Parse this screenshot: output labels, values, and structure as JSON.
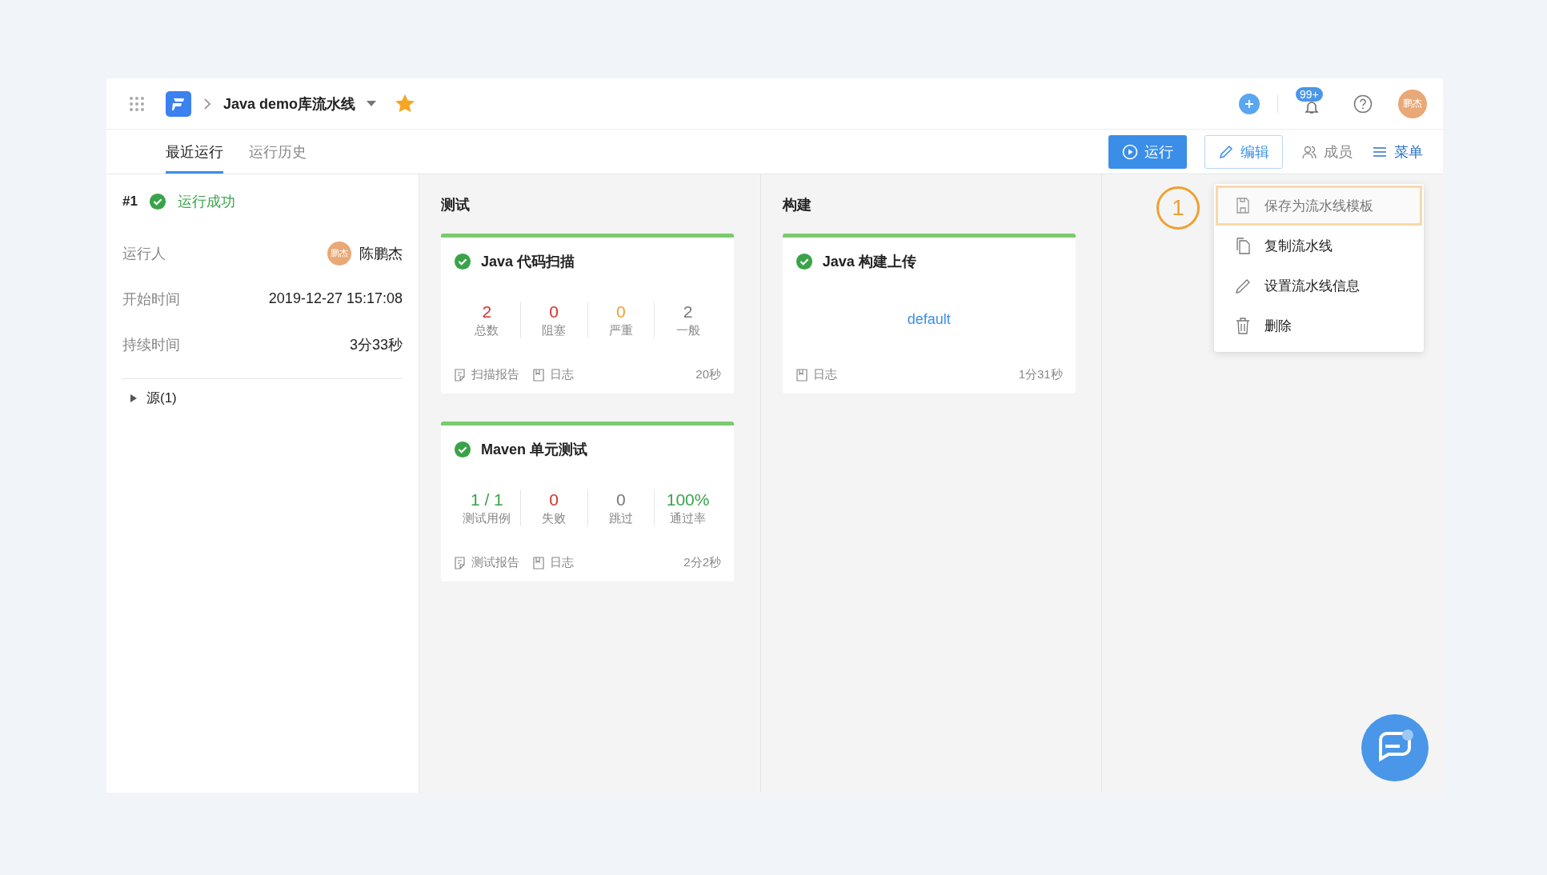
{
  "header": {
    "breadcrumb": "Java demo库流水线",
    "starred": true,
    "notification_badge": "99+",
    "avatar": "鹏杰"
  },
  "tabs": [
    {
      "label": "最近运行",
      "selected": true
    },
    {
      "label": "运行历史",
      "selected": false
    }
  ],
  "actions": [
    {
      "label": "运行",
      "kind": "primary"
    },
    {
      "label": "编辑",
      "kind": "outline"
    },
    {
      "label": "成员",
      "kind": "plain"
    },
    {
      "label": "菜单",
      "kind": "menu"
    }
  ],
  "run": {
    "number": "#1",
    "status": "运行成功",
    "fields": [
      {
        "label": "运行人",
        "value": "陈鹏杰",
        "avatar": "鹏杰"
      },
      {
        "label": "开始时间",
        "value": "2019-12-27 15:17:08"
      },
      {
        "label": "持续时间",
        "value": "3分33秒"
      }
    ],
    "source": {
      "label": "源(1)",
      "expanded": false
    }
  },
  "stages": [
    {
      "title": "测试",
      "jobs": [
        {
          "title": "Java 代码扫描",
          "kind": "metrics",
          "metrics": [
            {
              "value": "2",
              "label": "总数",
              "color": "#d0342c"
            },
            {
              "value": "0",
              "label": "阻塞",
              "color": "#d0342c"
            },
            {
              "value": "0",
              "label": "严重",
              "color": "#f0a030"
            },
            {
              "value": "2",
              "label": "一般",
              "color": "#777777"
            }
          ],
          "links": [
            {
              "label": "扫描报告",
              "kind": "report"
            },
            {
              "label": "日志",
              "kind": "log"
            }
          ],
          "duration": "20秒"
        },
        {
          "title": "Maven 单元测试",
          "kind": "metrics",
          "metrics": [
            {
              "value": "1 / 1",
              "label": "测试用例",
              "color": "#3aa34a"
            },
            {
              "value": "0",
              "label": "失败",
              "color": "#d0342c"
            },
            {
              "value": "0",
              "label": "跳过",
              "color": "#777777"
            },
            {
              "value": "100%",
              "label": "通过率",
              "color": "#3aa34a"
            }
          ],
          "links": [
            {
              "label": "测试报告",
              "kind": "report"
            },
            {
              "label": "日志",
              "kind": "log"
            }
          ],
          "duration": "2分2秒"
        }
      ]
    },
    {
      "title": "构建",
      "jobs": [
        {
          "title": "Java 构建上传",
          "kind": "text",
          "text": "default",
          "links": [
            {
              "label": "日志",
              "kind": "log"
            }
          ],
          "duration": "1分31秒"
        }
      ]
    }
  ],
  "menu": {
    "annotation": "1",
    "items": [
      {
        "label": "保存为流水线模板",
        "kind": "save",
        "selected": true
      },
      {
        "label": "复制流水线",
        "kind": "copy",
        "selected": false
      },
      {
        "label": "设置流水线信息",
        "kind": "edit",
        "selected": false
      },
      {
        "label": "删除",
        "kind": "delete",
        "selected": false
      }
    ]
  }
}
